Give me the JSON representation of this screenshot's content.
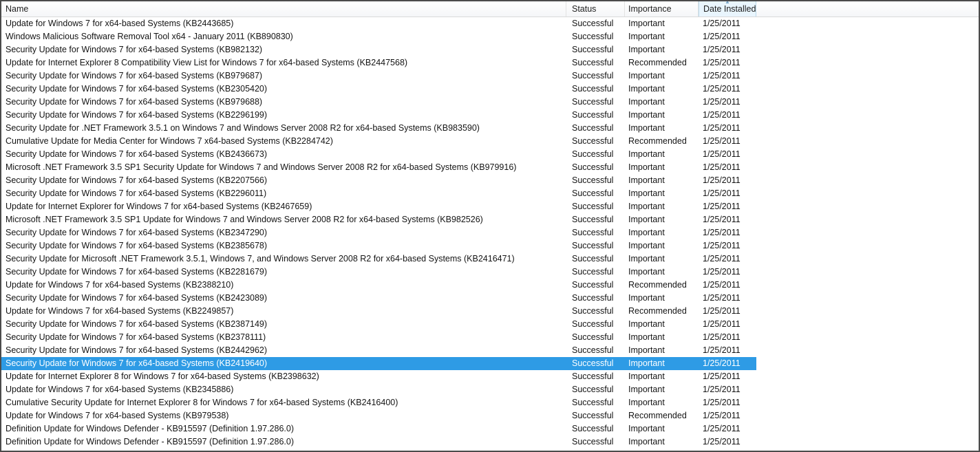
{
  "window": {
    "selection_color": "#2e9be5",
    "sorted_header_bg": "#e9f5fd",
    "sorted_header_border": "#b9d9ec"
  },
  "table": {
    "columns": {
      "name": "Name",
      "status": "Status",
      "importance": "Importance",
      "date": "Date Installed"
    },
    "sorted_column": "Date Installed",
    "sort_icon": "sort-arrow-icon",
    "rows": [
      {
        "name": "Update for Windows 7 for x64-based Systems (KB2443685)",
        "status": "Successful",
        "importance": "Important",
        "date": "1/25/2011",
        "selected": false
      },
      {
        "name": "Windows Malicious Software Removal Tool x64 - January 2011 (KB890830)",
        "status": "Successful",
        "importance": "Important",
        "date": "1/25/2011",
        "selected": false
      },
      {
        "name": "Security Update for Windows 7 for x64-based Systems (KB982132)",
        "status": "Successful",
        "importance": "Important",
        "date": "1/25/2011",
        "selected": false
      },
      {
        "name": "Update for Internet Explorer 8 Compatibility View List for Windows 7 for x64-based Systems (KB2447568)",
        "status": "Successful",
        "importance": "Recommended",
        "date": "1/25/2011",
        "selected": false
      },
      {
        "name": "Security Update for Windows 7 for x64-based Systems (KB979687)",
        "status": "Successful",
        "importance": "Important",
        "date": "1/25/2011",
        "selected": false
      },
      {
        "name": "Security Update for Windows 7 for x64-based Systems (KB2305420)",
        "status": "Successful",
        "importance": "Important",
        "date": "1/25/2011",
        "selected": false
      },
      {
        "name": "Security Update for Windows 7 for x64-based Systems (KB979688)",
        "status": "Successful",
        "importance": "Important",
        "date": "1/25/2011",
        "selected": false
      },
      {
        "name": "Security Update for Windows 7 for x64-based Systems (KB2296199)",
        "status": "Successful",
        "importance": "Important",
        "date": "1/25/2011",
        "selected": false
      },
      {
        "name": "Security Update for .NET Framework 3.5.1 on Windows 7 and Windows Server 2008 R2 for x64-based Systems (KB983590)",
        "status": "Successful",
        "importance": "Important",
        "date": "1/25/2011",
        "selected": false
      },
      {
        "name": "Cumulative Update for Media Center for Windows 7 x64-based Systems (KB2284742)",
        "status": "Successful",
        "importance": "Recommended",
        "date": "1/25/2011",
        "selected": false
      },
      {
        "name": "Security Update for Windows 7 for x64-based Systems (KB2436673)",
        "status": "Successful",
        "importance": "Important",
        "date": "1/25/2011",
        "selected": false
      },
      {
        "name": "Microsoft .NET Framework 3.5 SP1 Security Update for Windows 7 and Windows Server 2008 R2 for x64-based Systems (KB979916)",
        "status": "Successful",
        "importance": "Important",
        "date": "1/25/2011",
        "selected": false
      },
      {
        "name": "Security Update for Windows 7 for x64-based Systems (KB2207566)",
        "status": "Successful",
        "importance": "Important",
        "date": "1/25/2011",
        "selected": false
      },
      {
        "name": "Security Update for Windows 7 for x64-based Systems (KB2296011)",
        "status": "Successful",
        "importance": "Important",
        "date": "1/25/2011",
        "selected": false
      },
      {
        "name": "Update for Internet Explorer for Windows 7 for x64-based Systems (KB2467659)",
        "status": "Successful",
        "importance": "Important",
        "date": "1/25/2011",
        "selected": false
      },
      {
        "name": "Microsoft .NET Framework 3.5 SP1 Update for Windows 7 and Windows Server 2008 R2 for x64-based Systems (KB982526)",
        "status": "Successful",
        "importance": "Important",
        "date": "1/25/2011",
        "selected": false
      },
      {
        "name": "Security Update for Windows 7 for x64-based Systems (KB2347290)",
        "status": "Successful",
        "importance": "Important",
        "date": "1/25/2011",
        "selected": false
      },
      {
        "name": "Security Update for Windows 7 for x64-based Systems (KB2385678)",
        "status": "Successful",
        "importance": "Important",
        "date": "1/25/2011",
        "selected": false
      },
      {
        "name": "Security Update for Microsoft .NET Framework 3.5.1, Windows 7, and Windows Server 2008 R2 for x64-based Systems (KB2416471)",
        "status": "Successful",
        "importance": "Important",
        "date": "1/25/2011",
        "selected": false
      },
      {
        "name": "Security Update for Windows 7 for x64-based Systems (KB2281679)",
        "status": "Successful",
        "importance": "Important",
        "date": "1/25/2011",
        "selected": false
      },
      {
        "name": "Update for Windows 7 for x64-based Systems (KB2388210)",
        "status": "Successful",
        "importance": "Recommended",
        "date": "1/25/2011",
        "selected": false
      },
      {
        "name": "Security Update for Windows 7 for x64-based Systems (KB2423089)",
        "status": "Successful",
        "importance": "Important",
        "date": "1/25/2011",
        "selected": false
      },
      {
        "name": "Update for Windows 7 for x64-based Systems (KB2249857)",
        "status": "Successful",
        "importance": "Recommended",
        "date": "1/25/2011",
        "selected": false
      },
      {
        "name": "Security Update for Windows 7 for x64-based Systems (KB2387149)",
        "status": "Successful",
        "importance": "Important",
        "date": "1/25/2011",
        "selected": false
      },
      {
        "name": "Security Update for Windows 7 for x64-based Systems (KB2378111)",
        "status": "Successful",
        "importance": "Important",
        "date": "1/25/2011",
        "selected": false
      },
      {
        "name": "Security Update for Windows 7 for x64-based Systems (KB2442962)",
        "status": "Successful",
        "importance": "Important",
        "date": "1/25/2011",
        "selected": false
      },
      {
        "name": "Security Update for Windows 7 for x64-based Systems (KB2419640)",
        "status": "Successful",
        "importance": "Important",
        "date": "1/25/2011",
        "selected": true
      },
      {
        "name": "Update for Internet Explorer 8 for Windows 7 for x64-based Systems (KB2398632)",
        "status": "Successful",
        "importance": "Important",
        "date": "1/25/2011",
        "selected": false
      },
      {
        "name": "Update for Windows 7 for x64-based Systems (KB2345886)",
        "status": "Successful",
        "importance": "Important",
        "date": "1/25/2011",
        "selected": false
      },
      {
        "name": "Cumulative Security Update for Internet Explorer 8 for Windows 7 for x64-based Systems (KB2416400)",
        "status": "Successful",
        "importance": "Important",
        "date": "1/25/2011",
        "selected": false
      },
      {
        "name": "Update for Windows 7 for x64-based Systems (KB979538)",
        "status": "Successful",
        "importance": "Recommended",
        "date": "1/25/2011",
        "selected": false
      },
      {
        "name": "Definition Update for Windows Defender - KB915597 (Definition 1.97.286.0)",
        "status": "Successful",
        "importance": "Important",
        "date": "1/25/2011",
        "selected": false
      },
      {
        "name": "Definition Update for Windows Defender - KB915597 (Definition 1.97.286.0)",
        "status": "Successful",
        "importance": "Important",
        "date": "1/25/2011",
        "selected": false
      }
    ]
  }
}
